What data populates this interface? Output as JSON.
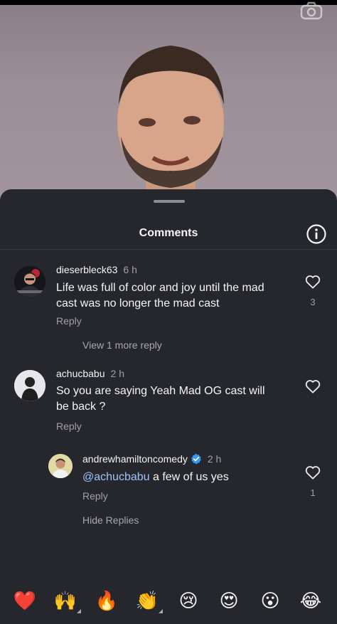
{
  "sheet": {
    "title": "Comments"
  },
  "comments": [
    {
      "username": "dieserbleck63",
      "time": "6 h",
      "text_line1": "Life was full of color and joy until the mad",
      "text_line2": "cast was no longer the mad cast",
      "reply_label": "Reply",
      "likes": "3",
      "view_more": "View 1 more reply"
    },
    {
      "username": "achucbabu",
      "time": "2 h",
      "text_line1": "So you are saying Yeah Mad OG cast will",
      "text_line2": "be back ?",
      "reply_label": "Reply",
      "likes": ""
    },
    {
      "username": "andrewhamiltoncomedy",
      "time": "2 h",
      "mention": "@achucbabu",
      "text_rest": " a few of us yes",
      "reply_label": "Reply",
      "likes": "1",
      "hide_replies": "Hide Replies"
    }
  ],
  "emoji_bar": [
    {
      "char": "❤️",
      "name": "heart-emoji",
      "has_variants": false
    },
    {
      "char": "🙌",
      "name": "raising-hands-emoji",
      "has_variants": true
    },
    {
      "char": "🔥",
      "name": "fire-emoji",
      "has_variants": false
    },
    {
      "char": "👏",
      "name": "clapping-hands-emoji",
      "has_variants": true
    },
    {
      "char": "😢",
      "name": "crying-face-emoji",
      "has_variants": false
    },
    {
      "char": "😍",
      "name": "heart-eyes-emoji",
      "has_variants": false
    },
    {
      "char": "😮",
      "name": "surprised-face-emoji",
      "has_variants": false
    },
    {
      "char": "😂",
      "name": "tears-of-joy-emoji",
      "has_variants": false
    }
  ],
  "icons": {
    "camera": "camera-icon",
    "info": "info-icon",
    "heart": "heart-outline-icon",
    "verified": "verified-badge-icon"
  },
  "colors": {
    "sheet_bg": "#25272c",
    "mention": "#9ec3ff",
    "verified": "#3897f0",
    "secondary_text": "#a0a0a5"
  }
}
